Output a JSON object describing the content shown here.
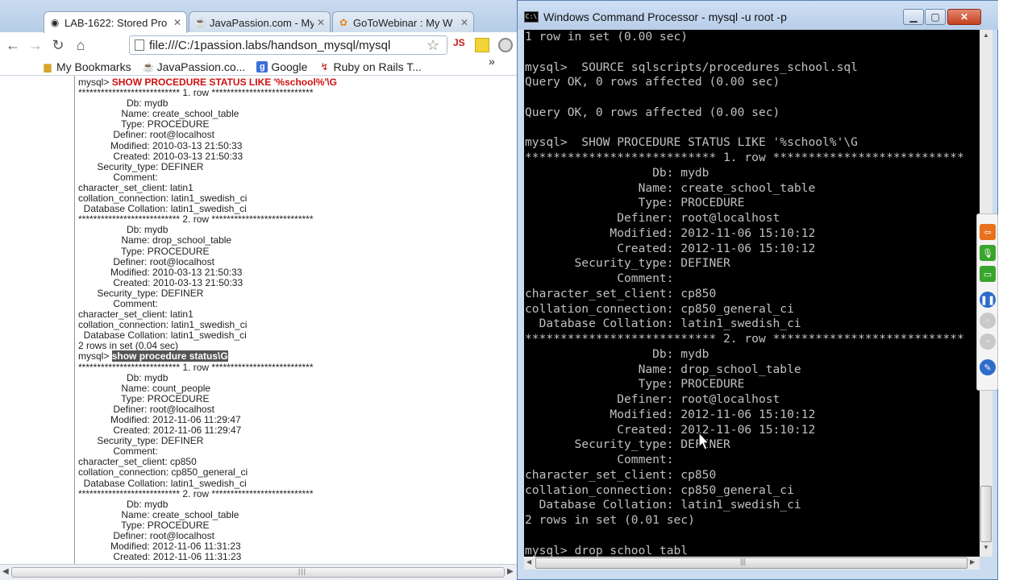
{
  "browser": {
    "tabs": [
      {
        "label": "LAB-1622: Stored Pro",
        "icon": "page-globe-icon",
        "active": true
      },
      {
        "label": "JavaPassion.com - My",
        "icon": "javapassion-icon",
        "active": false
      },
      {
        "label": "GoToWebinar : My W",
        "icon": "gotowebinar-flower-icon",
        "active": false
      }
    ],
    "url": "file:///C:/1passion.labs/handson_mysql/mysql",
    "ext_js": "JS",
    "bookmarks": [
      {
        "label": "My Bookmarks",
        "icon": "folder-icon"
      },
      {
        "label": "JavaPassion.co...",
        "icon": "javapassion-icon"
      },
      {
        "label": "Google",
        "icon": "google-icon"
      },
      {
        "label": "Ruby on Rails T...",
        "icon": "rails-icon"
      }
    ],
    "bookmarks_more": "»",
    "page_lines": [
      {
        "prefix": "mysql> ",
        "cmd": "SHOW PROCEDURE STATUS LIKE '%school%'\\G",
        "style": "red"
      },
      {
        "text": "*************************** 1. row ***************************"
      },
      {
        "text": "                  Db: mydb"
      },
      {
        "text": "                Name: create_school_table"
      },
      {
        "text": "                Type: PROCEDURE"
      },
      {
        "text": "             Definer: root@localhost"
      },
      {
        "text": "            Modified: 2010-03-13 21:50:33"
      },
      {
        "text": "             Created: 2010-03-13 21:50:33"
      },
      {
        "text": "       Security_type: DEFINER"
      },
      {
        "text": "             Comment:"
      },
      {
        "text": "character_set_client: latin1"
      },
      {
        "text": "collation_connection: latin1_swedish_ci"
      },
      {
        "text": "  Database Collation: latin1_swedish_ci"
      },
      {
        "text": "*************************** 2. row ***************************"
      },
      {
        "text": "                  Db: mydb"
      },
      {
        "text": "                Name: drop_school_table"
      },
      {
        "text": "                Type: PROCEDURE"
      },
      {
        "text": "             Definer: root@localhost"
      },
      {
        "text": "            Modified: 2010-03-13 21:50:33"
      },
      {
        "text": "             Created: 2010-03-13 21:50:33"
      },
      {
        "text": "       Security_type: DEFINER"
      },
      {
        "text": "             Comment:"
      },
      {
        "text": "character_set_client: latin1"
      },
      {
        "text": "collation_connection: latin1_swedish_ci"
      },
      {
        "text": "  Database Collation: latin1_swedish_ci"
      },
      {
        "text": "2 rows in set (0.04 sec)"
      },
      {
        "prefix": "mysql> ",
        "cmd": "show procedure status\\G",
        "style": "selected"
      },
      {
        "text": "*************************** 1. row ***************************"
      },
      {
        "text": "                  Db: mydb"
      },
      {
        "text": "                Name: count_people"
      },
      {
        "text": "                Type: PROCEDURE"
      },
      {
        "text": "             Definer: root@localhost"
      },
      {
        "text": "            Modified: 2012-11-06 11:29:47"
      },
      {
        "text": "             Created: 2012-11-06 11:29:47"
      },
      {
        "text": "       Security_type: DEFINER"
      },
      {
        "text": "             Comment:"
      },
      {
        "text": "character_set_client: cp850"
      },
      {
        "text": "collation_connection: cp850_general_ci"
      },
      {
        "text": "  Database Collation: latin1_swedish_ci"
      },
      {
        "text": "*************************** 2. row ***************************"
      },
      {
        "text": "                  Db: mydb"
      },
      {
        "text": "                Name: create_school_table"
      },
      {
        "text": "                Type: PROCEDURE"
      },
      {
        "text": "             Definer: root@localhost"
      },
      {
        "text": "            Modified: 2012-11-06 11:31:23"
      },
      {
        "text": "             Created: 2012-11-06 11:31:23"
      }
    ]
  },
  "cmd": {
    "title": "Windows Command Processor - mysql  -u root -p",
    "lines": [
      "1 row in set (0.00 sec)",
      "",
      "mysql>  SOURCE sqlscripts/procedures_school.sql",
      "Query OK, 0 rows affected (0.00 sec)",
      "",
      "Query OK, 0 rows affected (0.00 sec)",
      "",
      "mysql>  SHOW PROCEDURE STATUS LIKE '%school%'\\G",
      "*************************** 1. row ***************************",
      "                  Db: mydb",
      "                Name: create_school_table",
      "                Type: PROCEDURE",
      "             Definer: root@localhost",
      "            Modified: 2012-11-06 15:10:12",
      "             Created: 2012-11-06 15:10:12",
      "       Security_type: DEFINER",
      "             Comment:",
      "character_set_client: cp850",
      "collation_connection: cp850_general_ci",
      "  Database Collation: latin1_swedish_ci",
      "*************************** 2. row ***************************",
      "                  Db: mydb",
      "                Name: drop_school_table",
      "                Type: PROCEDURE",
      "             Definer: root@localhost",
      "            Modified: 2012-11-06 15:10:12",
      "             Created: 2012-11-06 15:10:12",
      "       Security_type: DEFINER",
      "             Comment:",
      "character_set_client: cp850",
      "collation_connection: cp850_general_ci",
      "  Database Collation: latin1_swedish_ci",
      "2 rows in set (0.01 sec)",
      "",
      "mysql> drop_school_tabl_"
    ]
  },
  "side_panel": {
    "buttons": [
      {
        "icon": "orange-arrow-icon",
        "color": "#e8711e"
      },
      {
        "icon": "microphone-icon",
        "color": "#3aa52e"
      },
      {
        "icon": "screen-share-icon",
        "color": "#3aa52e"
      },
      {
        "icon": "pause-icon",
        "color": "#2e6cc9"
      },
      {
        "icon": "disabled-stop-icon",
        "color": "#c9c9c9"
      },
      {
        "icon": "disabled-chat-icon",
        "color": "#c9c9c9"
      },
      {
        "icon": "pen-icon",
        "color": "#2e6cc9"
      }
    ]
  }
}
